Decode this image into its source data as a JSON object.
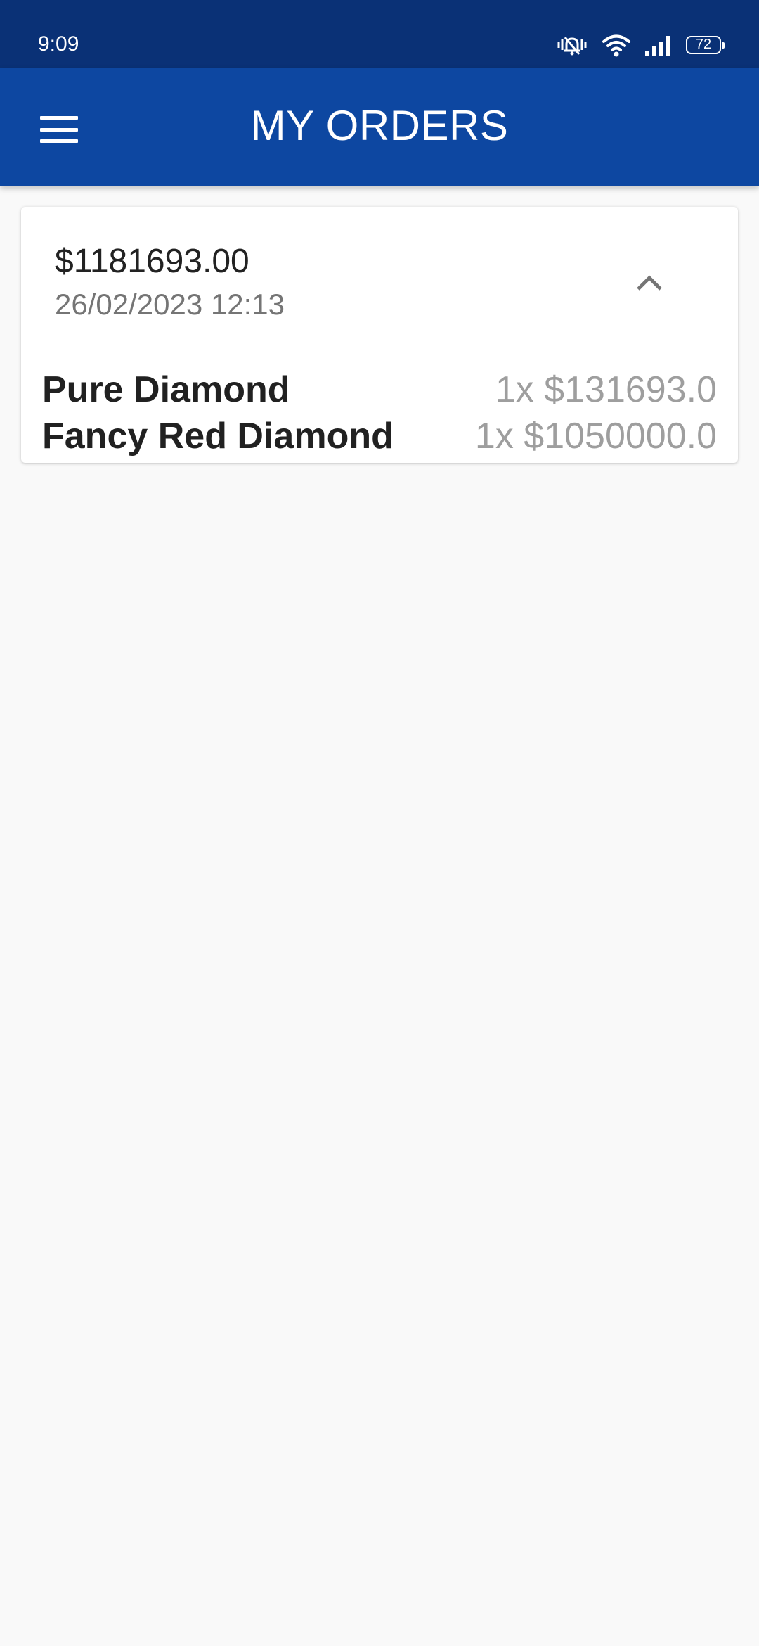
{
  "status_bar": {
    "time": "9:09",
    "icons": [
      "vibrate-mute-icon",
      "wifi-icon",
      "signal-icon",
      "battery-icon"
    ],
    "battery_level": "72"
  },
  "app_bar": {
    "title": "MY ORDERS",
    "menu_icon": "hamburger-menu-icon",
    "color": "#0d47a1"
  },
  "orders": [
    {
      "total": "$1181693.00",
      "date": "26/02/2023 12:13",
      "expanded_icon": "chevron-up-icon",
      "items": [
        {
          "name": "Pure Diamond",
          "qty_price": "1x $131693.0"
        },
        {
          "name": "Fancy Red Diamond",
          "qty_price": "1x $1050000.0"
        }
      ]
    }
  ],
  "colors": {
    "status_bar": "#0a3176",
    "background": "#f9f9f9",
    "primary_text": "#212121",
    "secondary_text": "#757575",
    "muted_text": "#9e9e9e"
  }
}
